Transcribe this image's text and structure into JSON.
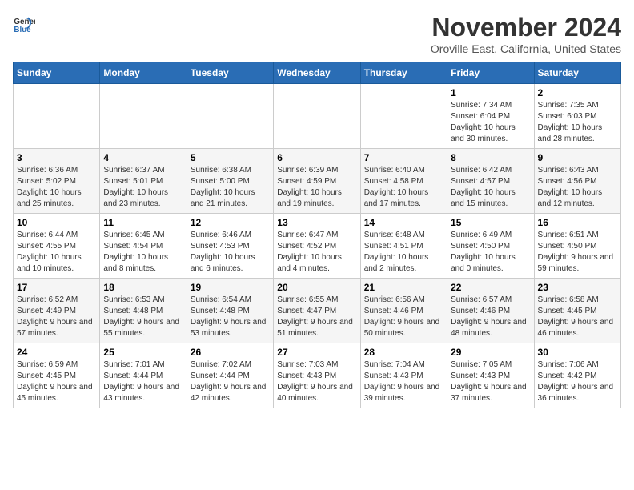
{
  "logo": {
    "text_general": "General",
    "text_blue": "Blue"
  },
  "title": "November 2024",
  "subtitle": "Oroville East, California, United States",
  "days_of_week": [
    "Sunday",
    "Monday",
    "Tuesday",
    "Wednesday",
    "Thursday",
    "Friday",
    "Saturday"
  ],
  "weeks": [
    [
      {
        "day": "",
        "info": ""
      },
      {
        "day": "",
        "info": ""
      },
      {
        "day": "",
        "info": ""
      },
      {
        "day": "",
        "info": ""
      },
      {
        "day": "",
        "info": ""
      },
      {
        "day": "1",
        "info": "Sunrise: 7:34 AM\nSunset: 6:04 PM\nDaylight: 10 hours and 30 minutes."
      },
      {
        "day": "2",
        "info": "Sunrise: 7:35 AM\nSunset: 6:03 PM\nDaylight: 10 hours and 28 minutes."
      }
    ],
    [
      {
        "day": "3",
        "info": "Sunrise: 6:36 AM\nSunset: 5:02 PM\nDaylight: 10 hours and 25 minutes."
      },
      {
        "day": "4",
        "info": "Sunrise: 6:37 AM\nSunset: 5:01 PM\nDaylight: 10 hours and 23 minutes."
      },
      {
        "day": "5",
        "info": "Sunrise: 6:38 AM\nSunset: 5:00 PM\nDaylight: 10 hours and 21 minutes."
      },
      {
        "day": "6",
        "info": "Sunrise: 6:39 AM\nSunset: 4:59 PM\nDaylight: 10 hours and 19 minutes."
      },
      {
        "day": "7",
        "info": "Sunrise: 6:40 AM\nSunset: 4:58 PM\nDaylight: 10 hours and 17 minutes."
      },
      {
        "day": "8",
        "info": "Sunrise: 6:42 AM\nSunset: 4:57 PM\nDaylight: 10 hours and 15 minutes."
      },
      {
        "day": "9",
        "info": "Sunrise: 6:43 AM\nSunset: 4:56 PM\nDaylight: 10 hours and 12 minutes."
      }
    ],
    [
      {
        "day": "10",
        "info": "Sunrise: 6:44 AM\nSunset: 4:55 PM\nDaylight: 10 hours and 10 minutes."
      },
      {
        "day": "11",
        "info": "Sunrise: 6:45 AM\nSunset: 4:54 PM\nDaylight: 10 hours and 8 minutes."
      },
      {
        "day": "12",
        "info": "Sunrise: 6:46 AM\nSunset: 4:53 PM\nDaylight: 10 hours and 6 minutes."
      },
      {
        "day": "13",
        "info": "Sunrise: 6:47 AM\nSunset: 4:52 PM\nDaylight: 10 hours and 4 minutes."
      },
      {
        "day": "14",
        "info": "Sunrise: 6:48 AM\nSunset: 4:51 PM\nDaylight: 10 hours and 2 minutes."
      },
      {
        "day": "15",
        "info": "Sunrise: 6:49 AM\nSunset: 4:50 PM\nDaylight: 10 hours and 0 minutes."
      },
      {
        "day": "16",
        "info": "Sunrise: 6:51 AM\nSunset: 4:50 PM\nDaylight: 9 hours and 59 minutes."
      }
    ],
    [
      {
        "day": "17",
        "info": "Sunrise: 6:52 AM\nSunset: 4:49 PM\nDaylight: 9 hours and 57 minutes."
      },
      {
        "day": "18",
        "info": "Sunrise: 6:53 AM\nSunset: 4:48 PM\nDaylight: 9 hours and 55 minutes."
      },
      {
        "day": "19",
        "info": "Sunrise: 6:54 AM\nSunset: 4:48 PM\nDaylight: 9 hours and 53 minutes."
      },
      {
        "day": "20",
        "info": "Sunrise: 6:55 AM\nSunset: 4:47 PM\nDaylight: 9 hours and 51 minutes."
      },
      {
        "day": "21",
        "info": "Sunrise: 6:56 AM\nSunset: 4:46 PM\nDaylight: 9 hours and 50 minutes."
      },
      {
        "day": "22",
        "info": "Sunrise: 6:57 AM\nSunset: 4:46 PM\nDaylight: 9 hours and 48 minutes."
      },
      {
        "day": "23",
        "info": "Sunrise: 6:58 AM\nSunset: 4:45 PM\nDaylight: 9 hours and 46 minutes."
      }
    ],
    [
      {
        "day": "24",
        "info": "Sunrise: 6:59 AM\nSunset: 4:45 PM\nDaylight: 9 hours and 45 minutes."
      },
      {
        "day": "25",
        "info": "Sunrise: 7:01 AM\nSunset: 4:44 PM\nDaylight: 9 hours and 43 minutes."
      },
      {
        "day": "26",
        "info": "Sunrise: 7:02 AM\nSunset: 4:44 PM\nDaylight: 9 hours and 42 minutes."
      },
      {
        "day": "27",
        "info": "Sunrise: 7:03 AM\nSunset: 4:43 PM\nDaylight: 9 hours and 40 minutes."
      },
      {
        "day": "28",
        "info": "Sunrise: 7:04 AM\nSunset: 4:43 PM\nDaylight: 9 hours and 39 minutes."
      },
      {
        "day": "29",
        "info": "Sunrise: 7:05 AM\nSunset: 4:43 PM\nDaylight: 9 hours and 37 minutes."
      },
      {
        "day": "30",
        "info": "Sunrise: 7:06 AM\nSunset: 4:42 PM\nDaylight: 9 hours and 36 minutes."
      }
    ]
  ]
}
